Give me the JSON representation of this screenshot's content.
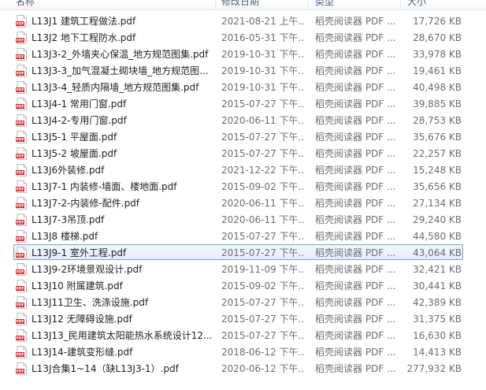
{
  "columns": {
    "name": "名称",
    "date": "修改日期",
    "type": "类型",
    "size": "大小"
  },
  "icon_colors": {
    "pdf_red": "#d8262d",
    "selection_border": "#7da2ce"
  },
  "files": [
    {
      "name": "L13J1 建筑工程做法.pdf",
      "date": "2021-08-21 上午...",
      "type": "稻壳阅读器 PDF ...",
      "size": "17,726 KB"
    },
    {
      "name": "L13J2 地下工程防水.pdf",
      "date": "2016-05-31 下午...",
      "type": "稻壳阅读器 PDF ...",
      "size": "28,670 KB"
    },
    {
      "name": "L13J3-2_外墙夹心保温_地方规范图集.pdf",
      "date": "2019-10-31 下午...",
      "type": "稻壳阅读器 PDF ...",
      "size": "33,978 KB"
    },
    {
      "name": "L13J3-3_加气混凝土砌块墙_地方规范图...",
      "date": "2019-10-31 下午...",
      "type": "稻壳阅读器 PDF ...",
      "size": "19,461 KB"
    },
    {
      "name": "L13J3-4_轻质内隔墙_地方规范图集.pdf",
      "date": "2019-10-31 下午...",
      "type": "稻壳阅读器 PDF ...",
      "size": "40,498 KB"
    },
    {
      "name": "L13J4-1 常用门窗.pdf",
      "date": "2015-07-27 下午...",
      "type": "稻壳阅读器 PDF ...",
      "size": "39,885 KB"
    },
    {
      "name": "L13J4-2-专用门窗.pdf",
      "date": "2020-06-11 下午...",
      "type": "稻壳阅读器 PDF ...",
      "size": "28,753 KB"
    },
    {
      "name": "L13J5-1 平屋面.pdf",
      "date": "2015-07-27 下午...",
      "type": "稻壳阅读器 PDF ...",
      "size": "35,676 KB"
    },
    {
      "name": "L13J5-2 坡屋面.pdf",
      "date": "2015-07-27 下午...",
      "type": "稻壳阅读器 PDF ...",
      "size": "22,257 KB"
    },
    {
      "name": "L13J6外装修.pdf",
      "date": "2021-12-22 下午...",
      "type": "稻壳阅读器 PDF ...",
      "size": "15,248 KB"
    },
    {
      "name": "L13J7-1 内装修-墙面、楼地面.pdf",
      "date": "2015-09-02 下午...",
      "type": "稻壳阅读器 PDF ...",
      "size": "35,656 KB"
    },
    {
      "name": "L13J7-2-内装修-配件.pdf",
      "date": "2020-06-11 下午...",
      "type": "稻壳阅读器 PDF ...",
      "size": "27,134 KB"
    },
    {
      "name": "L13J7-3吊顶.pdf",
      "date": "2020-06-11 下午...",
      "type": "稻壳阅读器 PDF ...",
      "size": "29,240 KB"
    },
    {
      "name": "L13J8 楼梯.pdf",
      "date": "2015-07-27 下午...",
      "type": "稻壳阅读器 PDF ...",
      "size": "44,580 KB"
    },
    {
      "name": "L13J9-1 室外工程.pdf",
      "date": "2015-07-27 下午...",
      "type": "稻壳阅读器 PDF ...",
      "size": "43,064 KB",
      "selected": true
    },
    {
      "name": "L13J9-2环境景观设计.pdf",
      "date": "2019-11-09 下午...",
      "type": "稻壳阅读器 PDF ...",
      "size": "32,421 KB"
    },
    {
      "name": "L13J10 附属建筑.pdf",
      "date": "2015-09-02 下午...",
      "type": "稻壳阅读器 PDF ...",
      "size": "30,441 KB"
    },
    {
      "name": "L13J11卫生、洗涤设施.pdf",
      "date": "2015-07-27 下午...",
      "type": "稻壳阅读器 PDF ...",
      "size": "42,389 KB"
    },
    {
      "name": "L13J12 无障碍设施.pdf",
      "date": "2015-07-27 下午...",
      "type": "稻壳阅读器 PDF ...",
      "size": "31,375 KB"
    },
    {
      "name": "L13J13_民用建筑太阳能热水系统设计12...",
      "date": "2015-07-27 下午...",
      "type": "稻壳阅读器 PDF ...",
      "size": "16,630 KB"
    },
    {
      "name": "L13J14-建筑变形缝.pdf",
      "date": "2018-06-12 下午...",
      "type": "稻壳阅读器 PDF ...",
      "size": "14,413 KB"
    },
    {
      "name": "L13J合集1~14（缺L13J3-1）.pdf",
      "date": "2020-06-12 下午...",
      "type": "稻壳阅读器 PDF ...",
      "size": "277,932 KB"
    }
  ]
}
